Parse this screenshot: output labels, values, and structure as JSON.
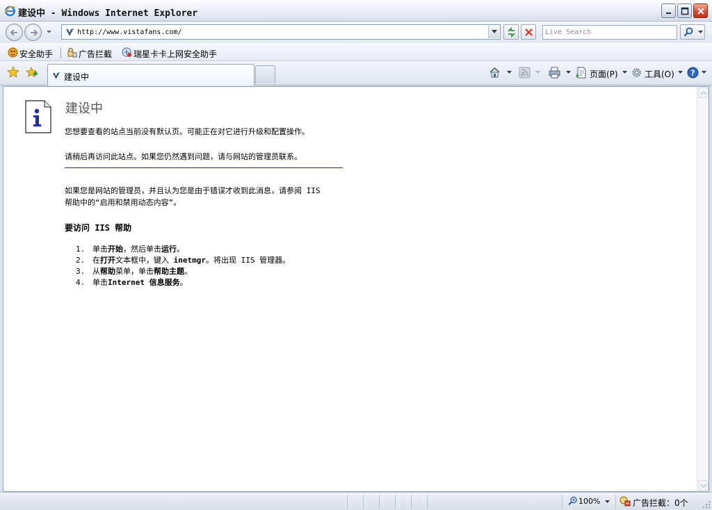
{
  "window": {
    "title": "建设中 - Windows Internet Explorer",
    "controls": [
      "minimize",
      "maximize",
      "close"
    ]
  },
  "address_bar": {
    "url": "http://www.vistafans.com/",
    "search_placeholder": "Live Search"
  },
  "links_bar": {
    "items": [
      {
        "label": "安全助手",
        "icon": "shield-icon"
      },
      {
        "label": "广告拦截",
        "icon": "adblock-icon"
      },
      {
        "label": "瑞星卡卡上网安全助手",
        "icon": "rising-icon"
      }
    ]
  },
  "command_bar": {
    "tab_title": "建设中",
    "page_menu": "页面(P)",
    "tools_menu": "工具(O)"
  },
  "content": {
    "heading": "建设中",
    "message1": "您想要查看的站点当前没有默认页。可能正在对它进行升级和配置操作。",
    "message2": "请稍后再访问此站点。如果您仍然遇到问题，请与网站的管理员联系。",
    "admin_line1": "如果您是网站的管理员，并且认为您是由于错误才收到此消息，请参阅 IIS",
    "admin_line2": "帮助中的“启用和禁用动态内容”。",
    "subheading": "要访问 IIS 帮助",
    "steps": [
      {
        "num": "1.",
        "a": "单击",
        "b1": "开始",
        "c": "，然后单击",
        "b2": "运行",
        "d": "。"
      },
      {
        "num": "2.",
        "a": "在",
        "b1": "打开",
        "c": "文本框中，键入 ",
        "b2": "inetmgr",
        "d": "。将出现 IIS 管理器。"
      },
      {
        "num": "3.",
        "a": "从",
        "b1": "帮助",
        "c": "菜单，单击",
        "b2": "帮助主题",
        "d": "。"
      },
      {
        "num": "4.",
        "a": "单击",
        "b1": "Internet 信息服务",
        "c": "",
        "b2": "",
        "d": "。"
      }
    ]
  },
  "status_bar": {
    "zoom": "100%",
    "popup_blocker": "广告拦截：0个"
  },
  "colors": {
    "frame_bg": "#dbe3ee",
    "rule_line": "#1d2f6e",
    "close_button": "#d8472a",
    "info_icon_blue": "#1a2bb5"
  }
}
